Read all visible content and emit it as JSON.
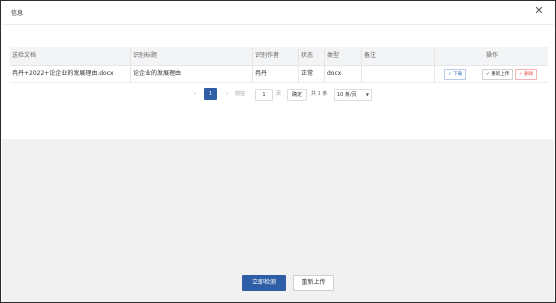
{
  "dialog": {
    "title": "信息",
    "close_symbol": "✕"
  },
  "table": {
    "headers": [
      "送检文档",
      "识别标题",
      "识别作者",
      "状态",
      "类型",
      "备注",
      "操作"
    ],
    "rows": [
      {
        "document": "冉丹+2022+论企业的发展理由.docx",
        "title": "论企业的发展理由",
        "author": "冉丹",
        "status": "正常",
        "type": "docx",
        "remark": "",
        "ops": {
          "download": "✓ 下载",
          "reupload": "✓ 重新上传",
          "delete": "✓ 删除"
        }
      }
    ]
  },
  "pagination": {
    "prev": "‹",
    "current_page": "1",
    "next": "›",
    "goto_label": "前往",
    "goto_value": "1",
    "page_label": "页",
    "confirm": "确定",
    "total": "共 1 条",
    "page_size": "10 条/页",
    "caret": "▼"
  },
  "footer": {
    "detect_button": "立即检测",
    "reupload_button": "重新上传"
  },
  "colors": {
    "primary": "#2e5fa6",
    "danger": "#e0453d",
    "link": "#3b73c3"
  }
}
